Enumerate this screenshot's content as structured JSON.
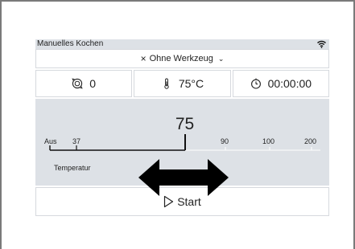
{
  "status": {
    "title": "Manuelles Kochen",
    "wifi_icon": "wifi-icon"
  },
  "tool": {
    "label": "Ohne Werkzeug",
    "x_glyph": "×",
    "chevron_glyph": "⌄"
  },
  "params": {
    "rotation": {
      "icon": "rotation-icon",
      "value": "0"
    },
    "temperature": {
      "icon": "thermometer-icon",
      "value": "75°C"
    },
    "timer": {
      "icon": "timer-icon",
      "value": "00:00:00"
    }
  },
  "slider": {
    "current_value": "75",
    "value": 75,
    "ticks": [
      {
        "label": "Aus",
        "value": 0
      },
      {
        "label": "37",
        "value": 37
      },
      {
        "label": "90",
        "value": 90
      },
      {
        "label": "100",
        "value": 100
      },
      {
        "label": "200",
        "value": 200
      }
    ],
    "label": "Temperatur"
  },
  "start": {
    "label": "Start",
    "icon": "play-icon"
  },
  "overlay": {
    "icon": "double-arrow-icon",
    "color": "#000000"
  },
  "colors": {
    "panel": "#dde1e6",
    "border": "#d6d9de"
  }
}
